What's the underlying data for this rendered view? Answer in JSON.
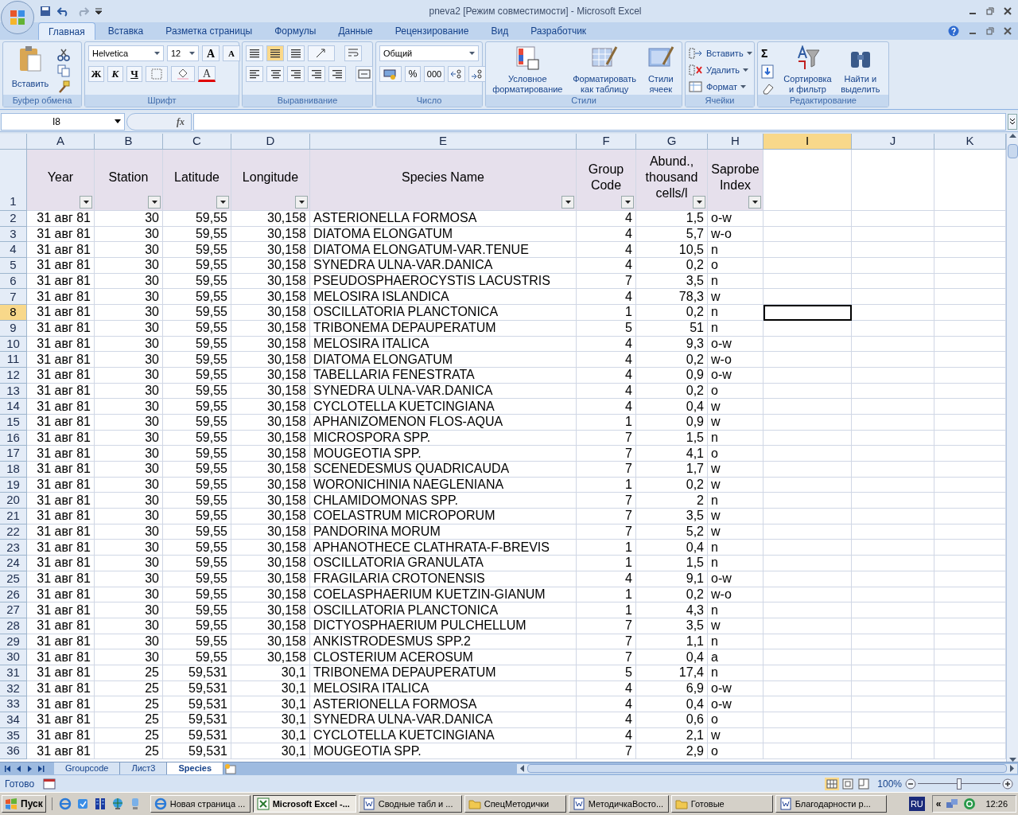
{
  "window": {
    "title": "pneva2  [Режим совместимости] - Microsoft Excel"
  },
  "ribbon_tabs": [
    {
      "label": "Главная",
      "selected": true
    },
    {
      "label": "Вставка",
      "selected": false
    },
    {
      "label": "Разметка страницы",
      "selected": false
    },
    {
      "label": "Формулы",
      "selected": false
    },
    {
      "label": "Данные",
      "selected": false
    },
    {
      "label": "Рецензирование",
      "selected": false
    },
    {
      "label": "Вид",
      "selected": false
    },
    {
      "label": "Разработчик",
      "selected": false
    }
  ],
  "ribbon": {
    "clipboard": {
      "paste": "Вставить",
      "label": "Буфер обмена"
    },
    "font": {
      "name": "Helvetica",
      "size": "12",
      "grow": "A",
      "shrink": "A",
      "bold": "Ж",
      "italic": "К",
      "underline": "Ч",
      "font_color_letter": "A",
      "label": "Шрифт"
    },
    "alignment": {
      "label": "Выравнивание"
    },
    "number": {
      "format": "Общий",
      "percent": "%",
      "thousands": "000",
      "label": "Число"
    },
    "styles": {
      "items": [
        "Условное форматирование",
        "Форматировать как таблицу",
        "Стили ячеек"
      ],
      "label": "Стили"
    },
    "cells": {
      "items": [
        "Вставить",
        "Удалить",
        "Формат"
      ],
      "label": "Ячейки"
    },
    "editing": {
      "sum": "Σ",
      "items": [
        "Сортировка и фильтр",
        "Найти и выделить"
      ],
      "label": "Редактирование"
    }
  },
  "formula_bar": {
    "name_box": "I8",
    "fx": "fx"
  },
  "table": {
    "columns": [
      {
        "letter": "A",
        "selected": false,
        "heading": "Year"
      },
      {
        "letter": "B",
        "selected": false,
        "heading": "Station"
      },
      {
        "letter": "C",
        "selected": false,
        "heading": "Latitude"
      },
      {
        "letter": "D",
        "selected": false,
        "heading": "Longitude"
      },
      {
        "letter": "E",
        "selected": false,
        "heading": "Species Name"
      },
      {
        "letter": "F",
        "selected": false,
        "heading": "Group Code"
      },
      {
        "letter": "G",
        "selected": false,
        "heading": "Abund., thousand cells/l"
      },
      {
        "letter": "H",
        "selected": false,
        "heading": "Saprobe Index"
      },
      {
        "letter": "I",
        "selected": true
      },
      {
        "letter": "J",
        "selected": false
      },
      {
        "letter": "K",
        "selected": false
      }
    ],
    "header_row_number": "1",
    "rows": [
      {
        "number": "2",
        "selected": false,
        "cells": [
          "31 авг 81",
          "30",
          "59,55",
          "30,158",
          "ASTERIONELLA FORMOSA",
          "4",
          "1,5",
          "o-w"
        ]
      },
      {
        "number": "3",
        "selected": false,
        "cells": [
          "31 авг 81",
          "30",
          "59,55",
          "30,158",
          "DIATOMA ELONGATUM",
          "4",
          "5,7",
          "w-o"
        ]
      },
      {
        "number": "4",
        "selected": false,
        "cells": [
          "31 авг 81",
          "30",
          "59,55",
          "30,158",
          "DIATOMA ELONGATUM-VAR.TENUE",
          "4",
          "10,5",
          "n"
        ]
      },
      {
        "number": "5",
        "selected": false,
        "cells": [
          "31 авг 81",
          "30",
          "59,55",
          "30,158",
          "SYNEDRA ULNA-VAR.DANICA",
          "4",
          "0,2",
          "o"
        ]
      },
      {
        "number": "6",
        "selected": false,
        "cells": [
          "31 авг 81",
          "30",
          "59,55",
          "30,158",
          "PSEUDOSPHAEROCYSTIS LACUSTRIS",
          "7",
          "3,5",
          "n"
        ]
      },
      {
        "number": "7",
        "selected": false,
        "cells": [
          "31 авг 81",
          "30",
          "59,55",
          "30,158",
          "MELOSIRA ISLANDICA",
          "4",
          "78,3",
          "w"
        ]
      },
      {
        "number": "8",
        "selected": true,
        "cells": [
          "31 авг 81",
          "30",
          "59,55",
          "30,158",
          "OSCILLATORIA PLANCTONICA",
          "1",
          "0,2",
          "n"
        ]
      },
      {
        "number": "9",
        "selected": false,
        "cells": [
          "31 авг 81",
          "30",
          "59,55",
          "30,158",
          "TRIBONEMA DEPAUPERATUM",
          "5",
          "51",
          "n"
        ]
      },
      {
        "number": "10",
        "selected": false,
        "cells": [
          "31 авг 81",
          "30",
          "59,55",
          "30,158",
          "MELOSIRA ITALICA",
          "4",
          "9,3",
          "o-w"
        ]
      },
      {
        "number": "11",
        "selected": false,
        "cells": [
          "31 авг 81",
          "30",
          "59,55",
          "30,158",
          "DIATOMA ELONGATUM",
          "4",
          "0,2",
          "w-o"
        ]
      },
      {
        "number": "12",
        "selected": false,
        "cells": [
          "31 авг 81",
          "30",
          "59,55",
          "30,158",
          "TABELLARIA FENESTRATA",
          "4",
          "0,9",
          "o-w"
        ]
      },
      {
        "number": "13",
        "selected": false,
        "cells": [
          "31 авг 81",
          "30",
          "59,55",
          "30,158",
          "SYNEDRA ULNA-VAR.DANICA",
          "4",
          "0,2",
          "o"
        ]
      },
      {
        "number": "14",
        "selected": false,
        "cells": [
          "31 авг 81",
          "30",
          "59,55",
          "30,158",
          "CYCLOTELLA KUETCINGIANA",
          "4",
          "0,4",
          "w"
        ]
      },
      {
        "number": "15",
        "selected": false,
        "cells": [
          "31 авг 81",
          "30",
          "59,55",
          "30,158",
          "APHANIZOMENON FLOS-AQUA",
          "1",
          "0,9",
          "w"
        ]
      },
      {
        "number": "16",
        "selected": false,
        "cells": [
          "31 авг 81",
          "30",
          "59,55",
          "30,158",
          "MICROSPORA SPP.",
          "7",
          "1,5",
          "n"
        ]
      },
      {
        "number": "17",
        "selected": false,
        "cells": [
          "31 авг 81",
          "30",
          "59,55",
          "30,158",
          "MOUGEOTIA SPP.",
          "7",
          "4,1",
          "o"
        ]
      },
      {
        "number": "18",
        "selected": false,
        "cells": [
          "31 авг 81",
          "30",
          "59,55",
          "30,158",
          "SCENEDESMUS QUADRICAUDA",
          "7",
          "1,7",
          "w"
        ]
      },
      {
        "number": "19",
        "selected": false,
        "cells": [
          "31 авг 81",
          "30",
          "59,55",
          "30,158",
          "WORONICHINIA NAEGLENIANA",
          "1",
          "0,2",
          "w"
        ]
      },
      {
        "number": "20",
        "selected": false,
        "cells": [
          "31 авг 81",
          "30",
          "59,55",
          "30,158",
          "CHLAMIDOMONAS SPP.",
          "7",
          "2",
          "n"
        ]
      },
      {
        "number": "21",
        "selected": false,
        "cells": [
          "31 авг 81",
          "30",
          "59,55",
          "30,158",
          "COELASTRUM MICROPORUM",
          "7",
          "3,5",
          "w"
        ]
      },
      {
        "number": "22",
        "selected": false,
        "cells": [
          "31 авг 81",
          "30",
          "59,55",
          "30,158",
          "PANDORINA MORUM",
          "7",
          "5,2",
          "w"
        ]
      },
      {
        "number": "23",
        "selected": false,
        "cells": [
          "31 авг 81",
          "30",
          "59,55",
          "30,158",
          "APHANOTHECE CLATHRATA-F-BREVIS",
          "1",
          "0,4",
          "n"
        ]
      },
      {
        "number": "24",
        "selected": false,
        "cells": [
          "31 авг 81",
          "30",
          "59,55",
          "30,158",
          "OSCILLATORIA GRANULATA",
          "1",
          "1,5",
          "n"
        ]
      },
      {
        "number": "25",
        "selected": false,
        "cells": [
          "31 авг 81",
          "30",
          "59,55",
          "30,158",
          "FRAGILARIA CROTONENSIS",
          "4",
          "9,1",
          "o-w"
        ]
      },
      {
        "number": "26",
        "selected": false,
        "cells": [
          "31 авг 81",
          "30",
          "59,55",
          "30,158",
          "COELASPHAERIUM KUETZIN-GIANUM",
          "1",
          "0,2",
          "w-o"
        ]
      },
      {
        "number": "27",
        "selected": false,
        "cells": [
          "31 авг 81",
          "30",
          "59,55",
          "30,158",
          "OSCILLATORIA PLANCTONICA",
          "1",
          "4,3",
          "n"
        ]
      },
      {
        "number": "28",
        "selected": false,
        "cells": [
          "31 авг 81",
          "30",
          "59,55",
          "30,158",
          "DICTYOSPHAERIUM PULCHELLUM",
          "7",
          "3,5",
          "w"
        ]
      },
      {
        "number": "29",
        "selected": false,
        "cells": [
          "31 авг 81",
          "30",
          "59,55",
          "30,158",
          "ANKISTRODESMUS SPP.2",
          "7",
          "1,1",
          "n"
        ]
      },
      {
        "number": "30",
        "selected": false,
        "cells": [
          "31 авг 81",
          "30",
          "59,55",
          "30,158",
          "CLOSTERIUM ACEROSUM",
          "7",
          "0,4",
          "a"
        ]
      },
      {
        "number": "31",
        "selected": false,
        "cells": [
          "31 авг 81",
          "25",
          "59,531",
          "30,1",
          "TRIBONEMA DEPAUPERATUM",
          "5",
          "17,4",
          "n"
        ]
      },
      {
        "number": "32",
        "selected": false,
        "cells": [
          "31 авг 81",
          "25",
          "59,531",
          "30,1",
          "MELOSIRA ITALICA",
          "4",
          "6,9",
          "o-w"
        ]
      },
      {
        "number": "33",
        "selected": false,
        "cells": [
          "31 авг 81",
          "25",
          "59,531",
          "30,1",
          "ASTERIONELLA FORMOSA",
          "4",
          "0,4",
          "o-w"
        ]
      },
      {
        "number": "34",
        "selected": false,
        "cells": [
          "31 авг 81",
          "25",
          "59,531",
          "30,1",
          "SYNEDRA ULNA-VAR.DANICA",
          "4",
          "0,6",
          "o"
        ]
      },
      {
        "number": "35",
        "selected": false,
        "cells": [
          "31 авг 81",
          "25",
          "59,531",
          "30,1",
          "CYCLOTELLA KUETCINGIANA",
          "4",
          "2,1",
          "w"
        ]
      },
      {
        "number": "36",
        "selected": false,
        "cells": [
          "31 авг 81",
          "25",
          "59,531",
          "30,1",
          "MOUGEOTIA SPP.",
          "7",
          "2,9",
          "o"
        ]
      }
    ]
  },
  "sheet_tabs": [
    {
      "label": "Groupcode",
      "selected": false
    },
    {
      "label": "Лист3",
      "selected": false
    },
    {
      "label": "Species",
      "selected": true
    }
  ],
  "status_bar": {
    "status": "Готово",
    "zoom": "100%",
    "zoom_slider": {
      "level": 0.5
    }
  },
  "taskbar": {
    "start": "Пуск",
    "tasks": [
      {
        "label": "Новая страница ...",
        "kind": "browser",
        "selected": false
      },
      {
        "label": "Microsoft Excel -...",
        "kind": "excel",
        "selected": true
      },
      {
        "label": "Сводные табл и ...",
        "kind": "word",
        "selected": false
      },
      {
        "label": "СпецМетодички",
        "kind": "folder",
        "selected": false
      },
      {
        "label": "МетодичкаВосто...",
        "kind": "word",
        "selected": false
      },
      {
        "label": "Готовые",
        "kind": "folder",
        "selected": false
      },
      {
        "label": "Благодарности р...",
        "kind": "word",
        "selected": false
      }
    ],
    "language": "RU",
    "tray_expand": "«",
    "clock": "12:26"
  }
}
